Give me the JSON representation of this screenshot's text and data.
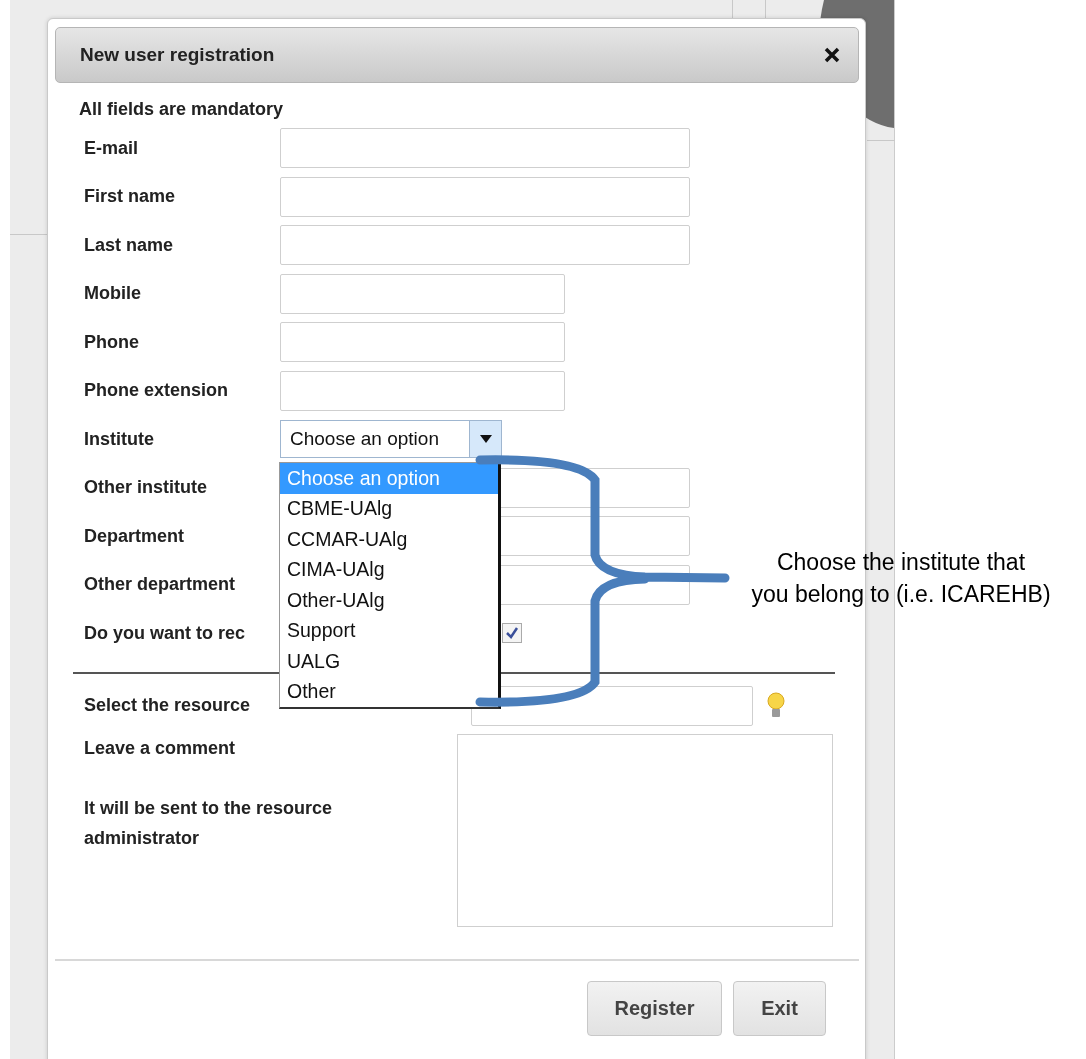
{
  "dialog": {
    "title": "New user registration",
    "note": "All fields are mandatory",
    "fields": [
      {
        "kind": "text",
        "label": "E-mail",
        "wide": true
      },
      {
        "kind": "text",
        "label": "First name",
        "wide": true
      },
      {
        "kind": "text",
        "label": "Last name",
        "wide": true
      },
      {
        "kind": "text",
        "label": "Mobile",
        "wide": false
      },
      {
        "kind": "text",
        "label": "Phone",
        "wide": false
      },
      {
        "kind": "text",
        "label": "Phone extension",
        "wide": false
      },
      {
        "kind": "select",
        "label": "Institute",
        "value": "Choose an option",
        "expanded": true
      },
      {
        "kind": "text",
        "label": "Other institute",
        "wide": true
      },
      {
        "kind": "text",
        "label": "Department",
        "wide": true
      },
      {
        "kind": "text",
        "label": "Other department",
        "wide": true
      },
      {
        "kind": "checkbox",
        "label": "Do you want to rec",
        "checked": true
      }
    ],
    "resource": {
      "label": "Select the resource"
    },
    "comment": {
      "label": "Leave a comment",
      "hint": "It will be sent to the resource administrator"
    },
    "buttons": [
      "Register",
      "Exit"
    ]
  },
  "dropdown": {
    "options": [
      {
        "label": "Choose an option",
        "selected": true
      },
      {
        "label": "CBME-UAlg",
        "selected": false
      },
      {
        "label": "CCMAR-UAlg",
        "selected": false
      },
      {
        "label": "CIMA-UAlg",
        "selected": false
      },
      {
        "label": "Other-UAlg",
        "selected": false
      },
      {
        "label": "Support",
        "selected": false
      },
      {
        "label": "UALG",
        "selected": false
      },
      {
        "label": "Other",
        "selected": false
      }
    ]
  },
  "annotation": {
    "lines": [
      "Choose the institute that",
      "you belong to (i.e. ICAREHB)"
    ]
  }
}
